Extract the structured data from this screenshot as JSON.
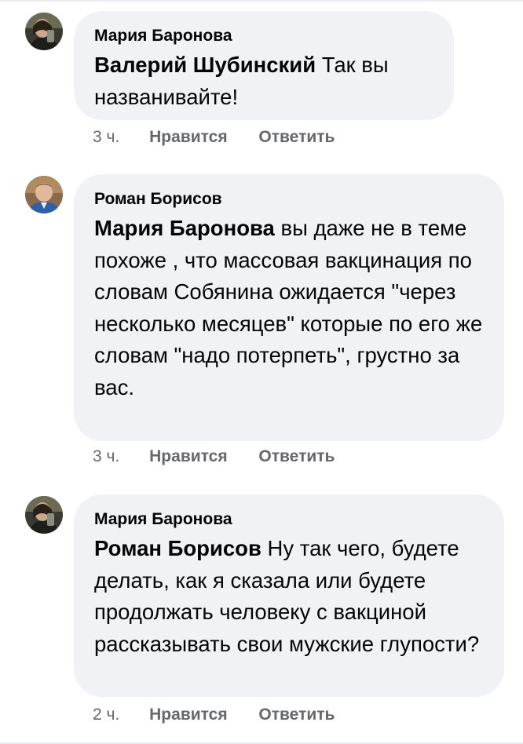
{
  "comments": [
    {
      "author": "Мария Баронова",
      "avatar_icon": "avatar-maria-photo",
      "mention": "Валерий Шубинский",
      "text": " Так вы названивайте!",
      "time": "3 ч.",
      "like_label": "Нравится",
      "reply_label": "Ответить"
    },
    {
      "author": "Роман Борисов",
      "avatar_icon": "avatar-roman-photo",
      "mention": "Мария Баронова",
      "text": " вы даже не в теме похоже , что массовая вакцинация по словам Собянина ожидается \"через несколько месяцев\" которые по его же словам \"надо потерпеть\", грустно за вас.",
      "time": "3 ч.",
      "like_label": "Нравится",
      "reply_label": "Ответить"
    },
    {
      "author": "Мария Баронова",
      "avatar_icon": "avatar-maria-photo",
      "mention": "Роман Борисов",
      "text": " Ну так чего, будете делать, как я сказала или будете продолжать человеку с вакциной рассказывать свои мужские глупости?",
      "time": "2 ч.",
      "like_label": "Нравится",
      "reply_label": "Ответить"
    }
  ]
}
